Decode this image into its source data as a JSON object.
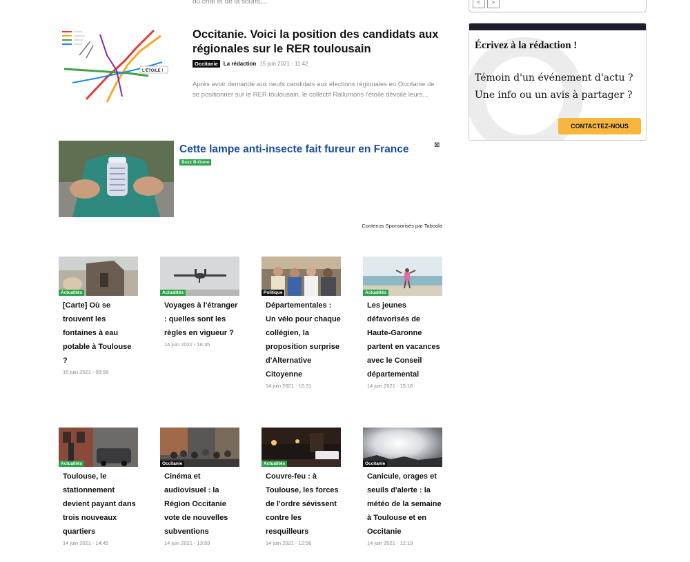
{
  "top_excerpt": "du chat et de la souris,...",
  "featured": {
    "title": "Occitanie. Voici la position des candidats aux régionales sur le RER toulousain",
    "category": "Occitanie",
    "author": "La rédaction",
    "date": "15 juin 2021 - 11:42",
    "excerpt": "Après avoir demandé aux neufs candidats aux élections régionales en Occitanie de se positionner sur le RER toulousain, le collectif Rallumons l'étoile dévoile leurs...",
    "map_badge": "L'ÉTOILE !"
  },
  "sponsored": {
    "title": "Cette lampe anti-insecte fait fureur en France",
    "brand": "Buzz B-Gone",
    "close": "⊠",
    "credit": "Contenus Sponsorisés par Taboola"
  },
  "cards": [
    {
      "category": "Actualités",
      "title": "[Carte] Où se trouvent les fontaines à eau potable à Toulouse ?",
      "date": "15 juin 2021 - 08:58"
    },
    {
      "category": "Actualités",
      "title": "Voyages à l'étranger : quelles sont les règles en vigueur ?",
      "date": "14 juin 2021 - 16:35"
    },
    {
      "category": "Politique",
      "title": "Départementales : Un vélo pour chaque collégien, la proposition surprise d'Alternative Citoyenne",
      "date": "14 juin 2021 - 16:31"
    },
    {
      "category": "Actualités",
      "title": "Les jeunes défavorisés de Haute-Garonne partent en vacances avec le Conseil départemental",
      "date": "14 juin 2021 - 15:18"
    },
    {
      "category": "Actualités",
      "title": "Toulouse, le stationnement devient payant dans trois nouveaux quartiers",
      "date": "14 juin 2021 - 14:45"
    },
    {
      "category": "Occitanie",
      "title": "Cinéma et audiovisuel : la Région Occitanie vote de nouvelles subventions",
      "date": "14 juin 2021 - 13:59"
    },
    {
      "category": "Actualités",
      "title": "Couvre-feu : à Toulouse, les forces de l'ordre sévissent contre les resquilleurs",
      "date": "14 juin 2021 - 12:56"
    },
    {
      "category": "Occitanie",
      "title": "Canicule, orages et seuils d'alerte : la météo de la semaine à Toulouse et en Occitanie",
      "date": "14 juin 2021 - 12:19"
    }
  ],
  "sidebar": {
    "prev": "<",
    "next": ">",
    "widget_title": "Écrivez à la rédaction !",
    "widget_text": "Témoin d'un événement d'actu ? Une info ou un avis à partager ?",
    "widget_button": "CONTACTEZ-NOUS"
  },
  "colors": {
    "tag_green": "#2ca24a",
    "tag_black": "#111111",
    "sponsor_link": "#1a4c9e",
    "cta": "#f7b73e"
  }
}
